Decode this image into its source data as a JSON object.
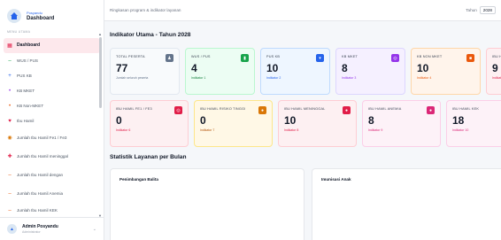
{
  "brand": {
    "app_name": "Posyandu",
    "title": "Dashboard"
  },
  "sidebar": {
    "section_label": "MENU UTAMA",
    "items": [
      {
        "label": "Dashboard",
        "icon": "grid-icon",
        "color": "#e11d48"
      },
      {
        "label": "WUS / PUS",
        "icon": "dash-icon",
        "color": "#16a34a"
      },
      {
        "label": "PUS KB",
        "icon": "plus-icon",
        "color": "#2563eb"
      },
      {
        "label": "KB MKET",
        "icon": "dot-icon",
        "color": "#9333ea"
      },
      {
        "label": "KB Non-MKET",
        "icon": "dot-icon",
        "color": "#ea580c"
      },
      {
        "label": "Ibu Hamil",
        "icon": "heart-icon",
        "color": "#e11d48"
      },
      {
        "label": "Jumlah Ibu Hamil Fe1 / Fe3",
        "icon": "pill-icon",
        "color": "#d97706"
      },
      {
        "label": "Jumlah Ibu Hamil meninggal",
        "icon": "cross-icon",
        "color": "#e11d48"
      },
      {
        "label": "Jumlah Ibu Hamil dengan",
        "icon": "dash-icon",
        "color": "#ea580c"
      },
      {
        "label": "Jumlah Ibu Hamil Anemia",
        "icon": "dash-icon",
        "color": "#ea580c"
      },
      {
        "label": "Jumlah Ibu Hamil KEK",
        "icon": "dash-icon",
        "color": "#ea580c"
      }
    ]
  },
  "user": {
    "name": "Admin Posyandu",
    "role": "Administrator"
  },
  "header": {
    "subtitle": "Ringkasan program & indikator layanan",
    "year_label": "Tahun",
    "year_value": "2028"
  },
  "indicators": {
    "title": "Indikator Utama - Tahun 2028",
    "row1": [
      {
        "label": "TOTAL PESERTA",
        "value": "77",
        "sub": "Jumlah seluruh peserta",
        "color_class": "c-gray",
        "icon_char": "♟"
      },
      {
        "label": "WUS / PUS",
        "value": "4",
        "sub": "Indikator 1",
        "color_class": "c-green",
        "icon_char": "▮"
      },
      {
        "label": "PUS KB",
        "value": "10",
        "sub": "Indikator 2",
        "color_class": "c-blue",
        "icon_char": "▾"
      },
      {
        "label": "KB MKET",
        "value": "8",
        "sub": "Indikator 3",
        "color_class": "c-purple",
        "icon_char": "◎"
      },
      {
        "label": "KB NON MKET",
        "value": "10",
        "sub": "Indikator 4",
        "color_class": "c-orange",
        "icon_char": "■"
      },
      {
        "label": "IBU HAMIL",
        "value": "9",
        "sub": "Indikator 5",
        "color_class": "c-red",
        "icon_char": "◎"
      }
    ],
    "row2": [
      {
        "label": "IBU HAMIL FE1 / FE3",
        "value": "0",
        "sub": "Indikator 6",
        "color_class": "c-red",
        "icon_char": "◎"
      },
      {
        "label": "IBU HAMIL RISIKO TINGGI",
        "value": "0",
        "sub": "Indikator 7",
        "color_class": "c-amber",
        "icon_char": "●"
      },
      {
        "label": "IBU HAMIL MENINGGAL",
        "value": "10",
        "sub": "Indikator 8",
        "color_class": "c-red",
        "icon_char": "●"
      },
      {
        "label": "IBU HAMIL ANEMIA",
        "value": "8",
        "sub": "Indikator 9",
        "color_class": "c-pink",
        "icon_char": "●"
      },
      {
        "label": "IBU HAMIL KEK",
        "value": "18",
        "sub": "Indikator 10",
        "color_class": "c-pink",
        "icon_char": "●"
      }
    ]
  },
  "stats": {
    "title": "Statistik Layanan per Bulan",
    "panels": [
      {
        "title": "Penimbangan Balita"
      },
      {
        "title": "Imunisasi Anak"
      }
    ]
  }
}
